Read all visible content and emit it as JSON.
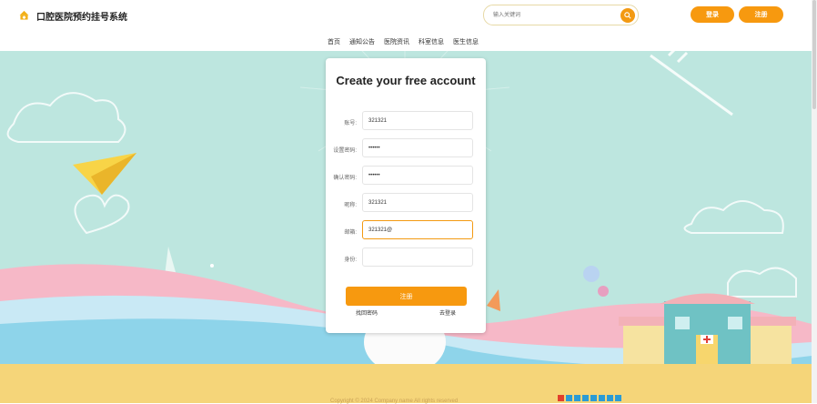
{
  "header": {
    "site_title": "口腔医院预约挂号系统",
    "search_placeholder": "输入关键词",
    "login_label": "登录",
    "register_label": "注册"
  },
  "nav": {
    "items": [
      "首页",
      "通知公告",
      "医院资讯",
      "科室信息",
      "医生信息"
    ]
  },
  "form": {
    "title": "Create your free account",
    "fields": [
      {
        "label": "账号:",
        "value": "321321"
      },
      {
        "label": "设置密码:",
        "value": "••••••"
      },
      {
        "label": "确认密码:",
        "value": "••••••"
      },
      {
        "label": "昵称:",
        "value": "321321"
      },
      {
        "label": "邮箱:",
        "value": "321321@"
      },
      {
        "label": "身份:",
        "value": ""
      }
    ],
    "submit_label": "注册",
    "forgot_label": "找回密码",
    "login_link_label": "去登录"
  },
  "footer": {
    "copyright": "Copyright © 2024 Company name All rights reserved"
  },
  "colors": {
    "accent": "#f7990f",
    "background": "#bde6df",
    "footer": "#f5d579"
  }
}
